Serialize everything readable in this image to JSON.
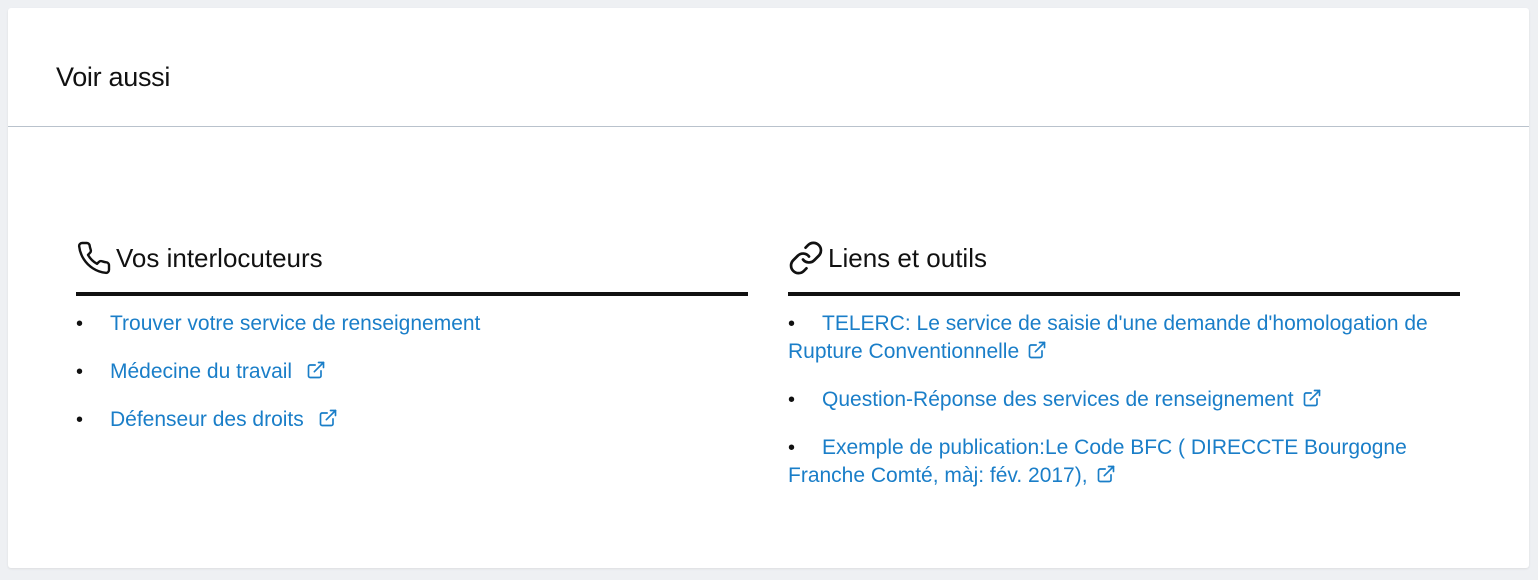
{
  "section": {
    "title": "Voir aussi"
  },
  "contacts": {
    "heading": "Vos interlocuteurs",
    "icon": "phone-icon",
    "items": [
      {
        "label": "Trouver votre service de renseignement",
        "external": false
      },
      {
        "label": "Médecine du travail",
        "external": true
      },
      {
        "label": "Défenseur des droits",
        "external": true
      }
    ]
  },
  "tools": {
    "heading": "Liens et outils",
    "icon": "link-icon",
    "items": [
      {
        "label": "TELERC: Le service de saisie d'une demande d'homologation de Rupture Conventionnelle",
        "external": true
      },
      {
        "label": "Question-Réponse des services de renseignement",
        "external": true
      },
      {
        "label": "Exemple de publication:Le Code BFC ( DIRECCTE Bourgogne Franche Comté, màj: fév. 2017),",
        "external": true
      }
    ]
  },
  "colors": {
    "link": "#1a7ec8",
    "text": "#111111",
    "background": "#eef0f3",
    "card": "#ffffff",
    "divider": "#b9c2cc"
  }
}
